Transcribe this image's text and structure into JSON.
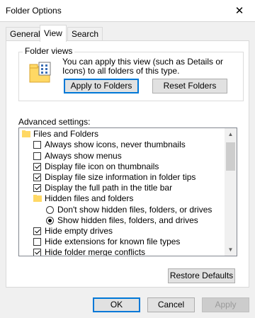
{
  "window": {
    "title": "Folder Options"
  },
  "tabs": [
    {
      "label": "General",
      "active": false
    },
    {
      "label": "View",
      "active": true
    },
    {
      "label": "Search",
      "active": false
    }
  ],
  "folder_views": {
    "label": "Folder views",
    "description": "You can apply this view (such as Details or Icons) to all folders of this type.",
    "apply_button": "Apply to Folders",
    "reset_button": "Reset Folders"
  },
  "advanced": {
    "label": "Advanced settings:",
    "rows": [
      {
        "type": "folder",
        "label": "Files and Folders"
      },
      {
        "type": "checkbox",
        "label": "Always show icons, never thumbnails",
        "checked": false
      },
      {
        "type": "checkbox",
        "label": "Always show menus",
        "checked": false
      },
      {
        "type": "checkbox",
        "label": "Display file icon on thumbnails",
        "checked": true
      },
      {
        "type": "checkbox",
        "label": "Display file size information in folder tips",
        "checked": true
      },
      {
        "type": "checkbox",
        "label": "Display the full path in the title bar",
        "checked": true
      },
      {
        "type": "folder",
        "label": "Hidden files and folders"
      },
      {
        "type": "radio",
        "label": "Don't show hidden files, folders, or drives",
        "checked": false
      },
      {
        "type": "radio",
        "label": "Show hidden files, folders, and drives",
        "checked": true
      },
      {
        "type": "checkbox",
        "label": "Hide empty drives",
        "checked": true
      },
      {
        "type": "checkbox",
        "label": "Hide extensions for known file types",
        "checked": false
      },
      {
        "type": "checkbox",
        "label": "Hide folder merge conflicts",
        "checked": true
      }
    ],
    "restore_button": "Restore Defaults"
  },
  "footer": {
    "ok": "OK",
    "cancel": "Cancel",
    "apply": "Apply"
  },
  "colors": {
    "accent": "#0078d7",
    "folder": "#ffd864"
  }
}
